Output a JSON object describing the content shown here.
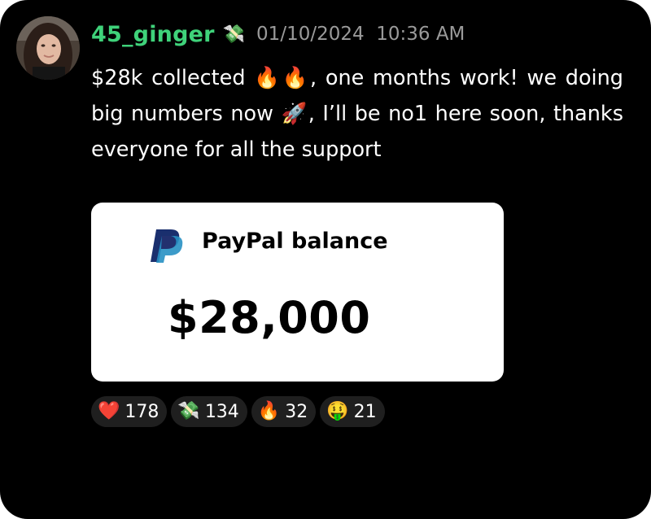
{
  "post": {
    "author": "45_ginger",
    "author_badge": "💸",
    "timestamp": "01/10/2024  10:36 AM",
    "message": "$28k collected 🔥🔥, one months work! we doing big numbers now 🚀, I’ll be no1 here soon, thanks everyone for all the support"
  },
  "attachment": {
    "label": "PayPal balance",
    "amount": "$28,000",
    "logo_icon": "paypal-logo-icon"
  },
  "reactions": [
    {
      "emoji": "❤️",
      "count": "178",
      "icon": "heart-icon"
    },
    {
      "emoji": "💸",
      "count": "134",
      "icon": "money-with-wings-icon"
    },
    {
      "emoji": "🔥",
      "count": "32",
      "icon": "fire-icon"
    },
    {
      "emoji": "🤑",
      "count": "21",
      "icon": "money-mouth-face-icon"
    }
  ],
  "colors": {
    "background": "#000000",
    "username": "#3fd27a",
    "timestamp": "#9a9a9a",
    "reaction_pill": "#1f1f1f",
    "paypal_dark_blue": "#1a2f6e",
    "paypal_light_blue": "#2790c3"
  }
}
